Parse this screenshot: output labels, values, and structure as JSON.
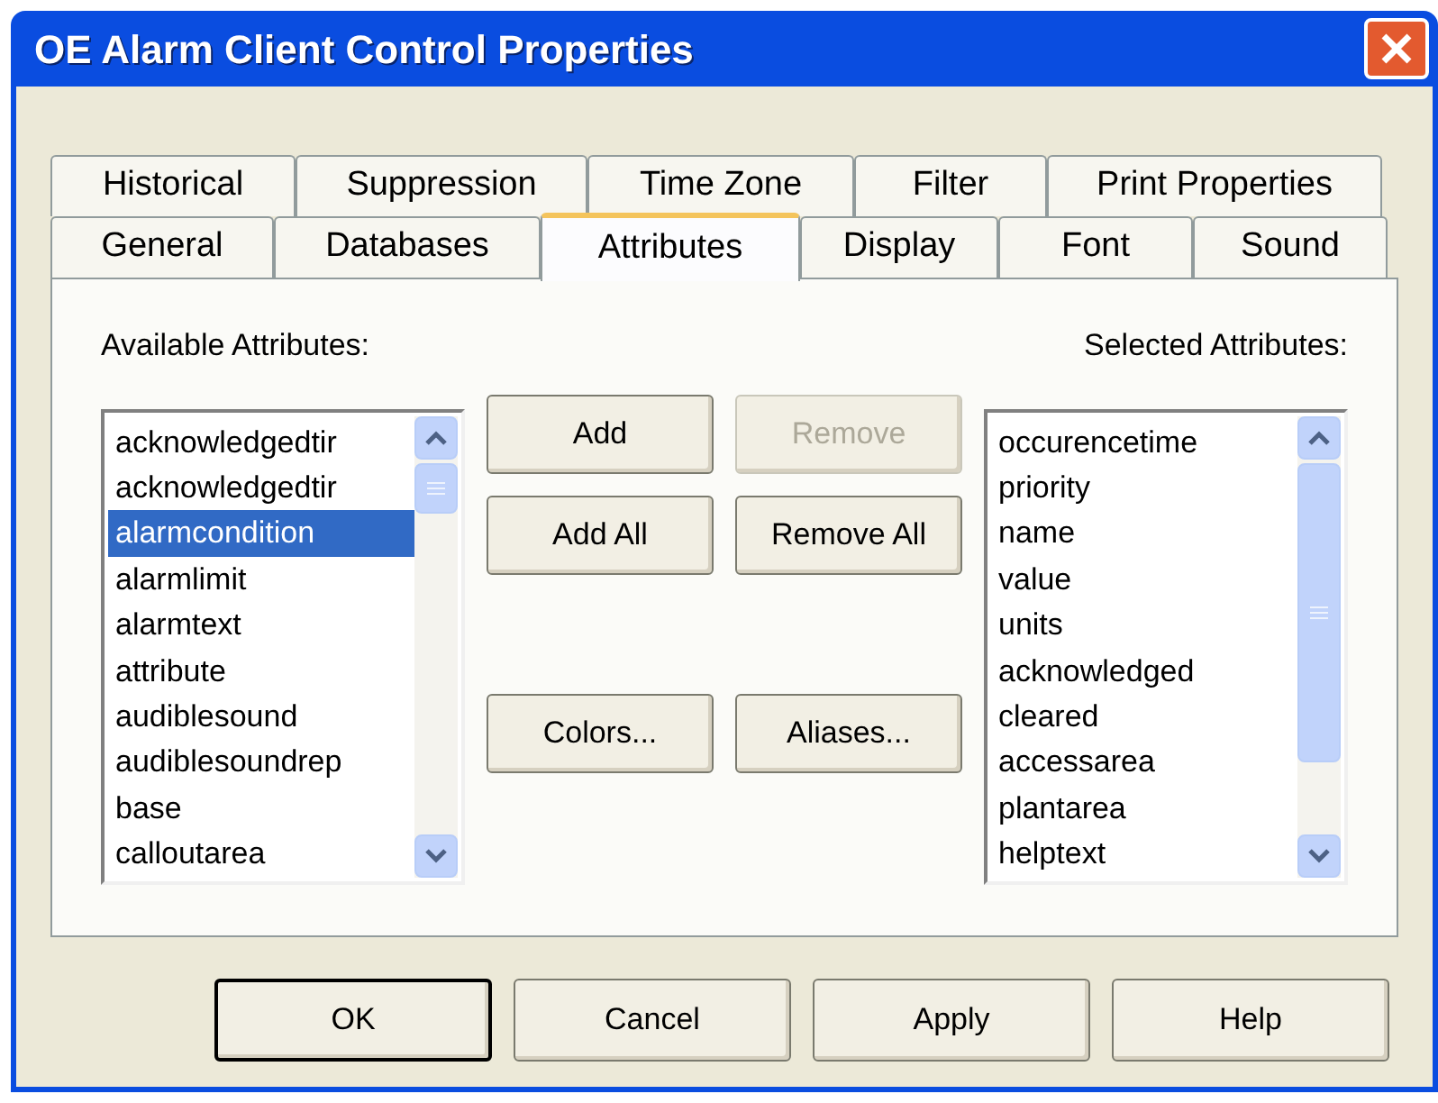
{
  "window": {
    "title": "OE Alarm Client Control Properties"
  },
  "tab_rows": [
    [
      {
        "label": "Historical",
        "selected": false
      },
      {
        "label": "Suppression",
        "selected": false
      },
      {
        "label": "Time Zone",
        "selected": false
      },
      {
        "label": "Filter",
        "selected": false
      },
      {
        "label": "Print Properties",
        "selected": false
      }
    ],
    [
      {
        "label": "General",
        "selected": false
      },
      {
        "label": "Databases",
        "selected": false
      },
      {
        "label": "Attributes",
        "selected": true
      },
      {
        "label": "Display",
        "selected": false
      },
      {
        "label": "Font",
        "selected": false
      },
      {
        "label": "Sound",
        "selected": false
      }
    ]
  ],
  "available": {
    "label": "Available Attributes:",
    "items": [
      {
        "text": "acknowledgedtir",
        "selected": false
      },
      {
        "text": "acknowledgedtir",
        "selected": false
      },
      {
        "text": "alarmcondition",
        "selected": true
      },
      {
        "text": "alarmlimit",
        "selected": false
      },
      {
        "text": "alarmtext",
        "selected": false
      },
      {
        "text": "attribute",
        "selected": false
      },
      {
        "text": "audiblesound",
        "selected": false
      },
      {
        "text": "audiblesoundrep",
        "selected": false
      },
      {
        "text": "base",
        "selected": false
      },
      {
        "text": "calloutarea",
        "selected": false
      }
    ]
  },
  "selected_list": {
    "label": "Selected Attributes:",
    "items": [
      {
        "text": "occurencetime",
        "selected": false
      },
      {
        "text": "priority",
        "selected": false
      },
      {
        "text": "name",
        "selected": false
      },
      {
        "text": "value",
        "selected": false
      },
      {
        "text": "units",
        "selected": false
      },
      {
        "text": "acknowledged",
        "selected": false
      },
      {
        "text": "cleared",
        "selected": false
      },
      {
        "text": "accessarea",
        "selected": false
      },
      {
        "text": "plantarea",
        "selected": false
      },
      {
        "text": "helptext",
        "selected": false
      }
    ]
  },
  "middle_buttons": [
    [
      {
        "label": "Add",
        "disabled": false
      },
      {
        "label": "Remove",
        "disabled": true
      }
    ],
    [
      {
        "label": "Add All",
        "disabled": false
      },
      {
        "label": "Remove All",
        "disabled": false
      }
    ],
    [
      {
        "label": "Colors...",
        "disabled": false
      },
      {
        "label": "Aliases...",
        "disabled": false
      }
    ]
  ],
  "buttons": [
    {
      "label": "OK",
      "default": true
    },
    {
      "label": "Cancel",
      "default": false
    },
    {
      "label": "Apply",
      "default": false
    },
    {
      "label": "Help",
      "default": false
    }
  ]
}
